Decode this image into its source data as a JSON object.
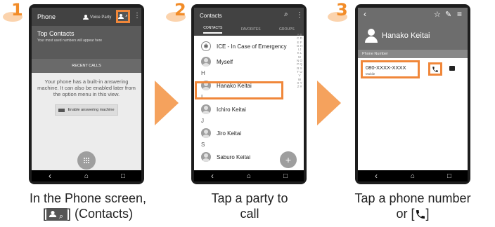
{
  "steps": [
    {
      "number": "1",
      "caption_line1": "In the Phone screen,",
      "caption_line2_prefix": "[",
      "caption_line2_suffix": "] (Contacts)",
      "phone": {
        "title": "Phone",
        "voice_party": "Voice Party",
        "top_contacts_title": "Top Contacts",
        "top_contacts_sub": "Your most used numbers will appear here",
        "recent_calls": "RECENT CALLS",
        "message": "Your phone has a built-in answering machine. It can also be enabled later from the option menu in this view.",
        "enable_button": "Enable answering machine"
      }
    },
    {
      "number": "2",
      "caption_line1": "Tap a party to",
      "caption_line2": "call",
      "phone": {
        "title": "Contacts",
        "tabs": [
          "CONTACTS",
          "FAVORITES",
          "GROUPS"
        ],
        "ice": "ICE - In Case of Emergency",
        "myself": "Myself",
        "letters": [
          "H",
          "I",
          "J",
          "S"
        ],
        "contacts": [
          "Hanako Keitai",
          "Ichiro Keitai",
          "Jiro Keitai",
          "Saburo Keitai"
        ],
        "alphabet": "A B C D E F G H I J K L M N O P Q R S T U V W X Y Z #"
      }
    },
    {
      "number": "3",
      "caption_line1": "Tap a phone number",
      "caption_line2_prefix": "or [",
      "caption_line2_suffix": "]",
      "phone": {
        "name": "Hanako Keitai",
        "section": "Phone Number",
        "number": "080-XXXX-XXXX",
        "type": "Mobile"
      }
    }
  ],
  "colors": {
    "accent": "#f0873a",
    "arrow": "#f5a25d",
    "header": "#424242"
  },
  "icons": {
    "back": "‹",
    "home": "⌂",
    "recents": "□",
    "star": "☆",
    "edit": "✎",
    "menu": "≡",
    "search": "⌕",
    "more": "⋮",
    "plus": "+"
  }
}
